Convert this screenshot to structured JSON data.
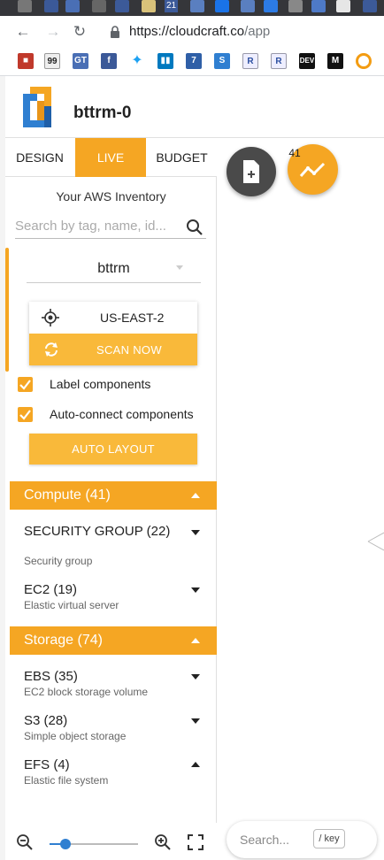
{
  "browser": {
    "url_host": "https://cloudcraft.co",
    "url_path": "/app",
    "tab_badge": "21",
    "bookmarks": [
      "99",
      "GT",
      "R",
      "R",
      "DEV",
      "M"
    ]
  },
  "app": {
    "project_name": "bttrm-0"
  },
  "tabs": [
    {
      "label": "DESIGN"
    },
    {
      "label": "LIVE"
    },
    {
      "label": "BUDGET"
    }
  ],
  "inventory": {
    "title": "Your AWS Inventory",
    "search_placeholder": "Search by tag, name, id...",
    "account": "bttrm",
    "region": "US-EAST-2",
    "scan_label": "SCAN NOW",
    "label_components": "Label components",
    "auto_connect": "Auto-connect components",
    "auto_layout": "AUTO LAYOUT"
  },
  "sections": [
    {
      "title": "Compute (41)",
      "items": [
        {
          "title": "SECURITY GROUP (22)",
          "subtitle": "Security group"
        },
        {
          "title": "EC2 (19)",
          "subtitle": "Elastic virtual server"
        }
      ]
    },
    {
      "title": "Storage (74)",
      "items": [
        {
          "title": "EBS (35)",
          "subtitle": "EC2 block storage volume"
        },
        {
          "title": "S3 (28)",
          "subtitle": "Simple object storage"
        },
        {
          "title": "EFS (4)",
          "subtitle": "Elastic file system"
        }
      ]
    }
  ],
  "canvas": {
    "live_badge": "41",
    "search_placeholder": "Search...",
    "search_key": "/ key"
  },
  "colors": {
    "accent": "#f5a623",
    "accent_light": "#f9b93a",
    "slider": "#2f7fd1"
  },
  "zoom": {
    "level": 0.18
  }
}
